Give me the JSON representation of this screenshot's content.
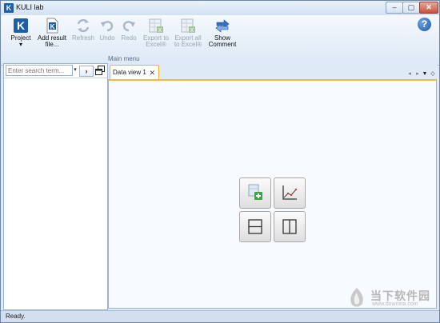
{
  "window": {
    "title": "KULI lab",
    "app_icon": "K",
    "caption_min": "–",
    "caption_max": "▢",
    "caption_close": "✕"
  },
  "ribbon": {
    "buttons": [
      {
        "label": "Project",
        "icon": "project-k-icon",
        "enabled": true
      },
      {
        "label": "Add result file...",
        "icon": "add-file-k-icon",
        "enabled": true
      },
      {
        "label": "Refresh",
        "icon": "refresh-icon",
        "enabled": false
      },
      {
        "label": "Undo",
        "icon": "undo-icon",
        "enabled": false
      },
      {
        "label": "Redo",
        "icon": "redo-icon",
        "enabled": false
      },
      {
        "label": "Export to Excel®",
        "icon": "excel-export-icon",
        "enabled": false
      },
      {
        "label": "Export all to Excel®",
        "icon": "excel-export-all-icon",
        "enabled": false
      },
      {
        "label": "Show Comment",
        "icon": "show-comment-icon",
        "enabled": true
      }
    ],
    "project_dropdown": "▾",
    "group_label": "Main menu",
    "help": "?"
  },
  "left_panel": {
    "search_placeholder": "Enter search term...",
    "search_dropdown": "▾",
    "go_button": "›"
  },
  "main": {
    "tabs": [
      {
        "label": "Data view 1",
        "close": "✕"
      }
    ],
    "nav": {
      "left": "◂",
      "right": "▸",
      "down": "▼",
      "options": "◇"
    },
    "layout_buttons": [
      {
        "name": "add-view",
        "icon": "add-view-icon"
      },
      {
        "name": "chart",
        "icon": "chart-icon"
      },
      {
        "name": "split-horizontal",
        "icon": "split-horizontal-icon"
      },
      {
        "name": "split-vertical",
        "icon": "split-vertical-icon"
      }
    ]
  },
  "status": {
    "text": "Ready."
  },
  "watermark": {
    "text": "当下软件园",
    "url": "www.downxia.com"
  },
  "colors": {
    "accent": "#1a5fa8",
    "tab_border": "#f0b030",
    "chrome": "#dfeaf7"
  }
}
